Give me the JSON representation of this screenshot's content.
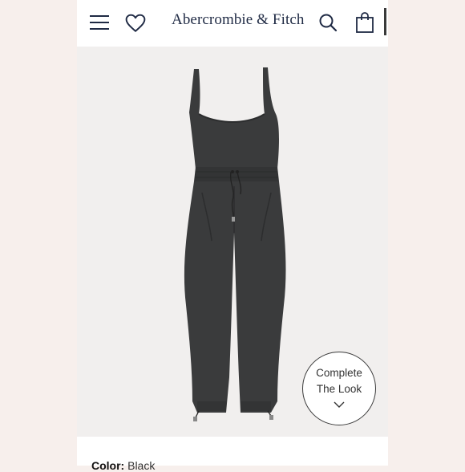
{
  "header": {
    "brand": "Abercrombie & Fitch",
    "menu_icon": "hamburger-menu-icon",
    "wishlist_icon": "heart-icon",
    "search_icon": "search-icon",
    "bag_icon": "shopping-bag-icon"
  },
  "product": {
    "image_alt": "Black sleeveless drawstring-waist jumpsuit",
    "complete_look_line1": "Complete",
    "complete_look_line2": "The Look",
    "chevron_icon": "chevron-down-icon",
    "color_label": "Color:",
    "color_value": "Black"
  },
  "colors": {
    "brand_navy": "#1f2a44",
    "garment": "#3a3b3c",
    "background": "#f1efee"
  }
}
